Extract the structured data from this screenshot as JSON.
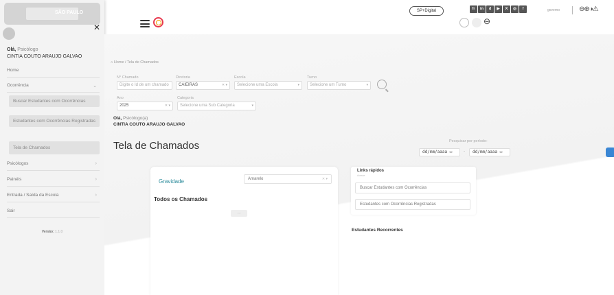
{
  "header": {
    "sp_digital": "SP+Digital",
    "social": [
      "fr",
      "in",
      "d",
      "▶",
      "X",
      "◎",
      "f"
    ],
    "gov_text": "governo",
    "accessibility": "⊖⊕◑⚠"
  },
  "sidebar": {
    "logo_text": "SÃO PAULO",
    "greeting_prefix": "Olá,",
    "greeting_role": "Psicólogo",
    "user_name": "CINTIA COUTO ARAUJO GALVAO",
    "items": [
      {
        "label": "Home"
      },
      {
        "label": "Ocorrência"
      },
      {
        "label": "Buscar Estudantes com Ocorrências"
      },
      {
        "label": "Estudantes com Ocorrências Registradas"
      },
      {
        "label": "Tela de Chamados"
      },
      {
        "label": "Psicólogos"
      },
      {
        "label": "Painéis"
      },
      {
        "label": "Entrada / Saída da Escola"
      },
      {
        "label": "Sair"
      }
    ],
    "version_label": "Versão:",
    "version_value": "1.1.0"
  },
  "breadcrumb": "Home / Tela de Chamados",
  "filters": {
    "chamado_label": "N° Chamado",
    "chamado_placeholder": "Digite o Id de um chamado",
    "diretoria_label": "Diretoria",
    "diretoria_value": "CAIEIRAS",
    "escola_label": "Escola",
    "escola_placeholder": "Selecione uma Escola",
    "turno_label": "Turno",
    "turno_placeholder": "Selecione um Turno",
    "ano_label": "Ano",
    "ano_value": "2025",
    "categoria_label": "Categoria",
    "categoria_placeholder": "Selecione uma Sub Categoria"
  },
  "greeting2": {
    "prefix": "Olá,",
    "role": "Psicólogo(a)",
    "name": "CINTIA COUTO ARAUJO GALVAO"
  },
  "page_title": "Tela de Chamados",
  "period": {
    "label": "Pesquisar por período:",
    "start": "dd/mm/aaaa",
    "end": "dd/mm/aaaa",
    "sep": "-"
  },
  "gravidade": {
    "label": "Gravidade",
    "value": "Amarelo"
  },
  "todos_title": "Todos os Chamados",
  "pager": "‹ ›",
  "links": {
    "title": "Links rápidos",
    "subtitle": "Acesse",
    "items": [
      "Buscar Estudantes com Ocorrências",
      "Estudantes com Ocorrências Registradas"
    ]
  },
  "recorrentes_title": "Estudantes Recorrentes"
}
